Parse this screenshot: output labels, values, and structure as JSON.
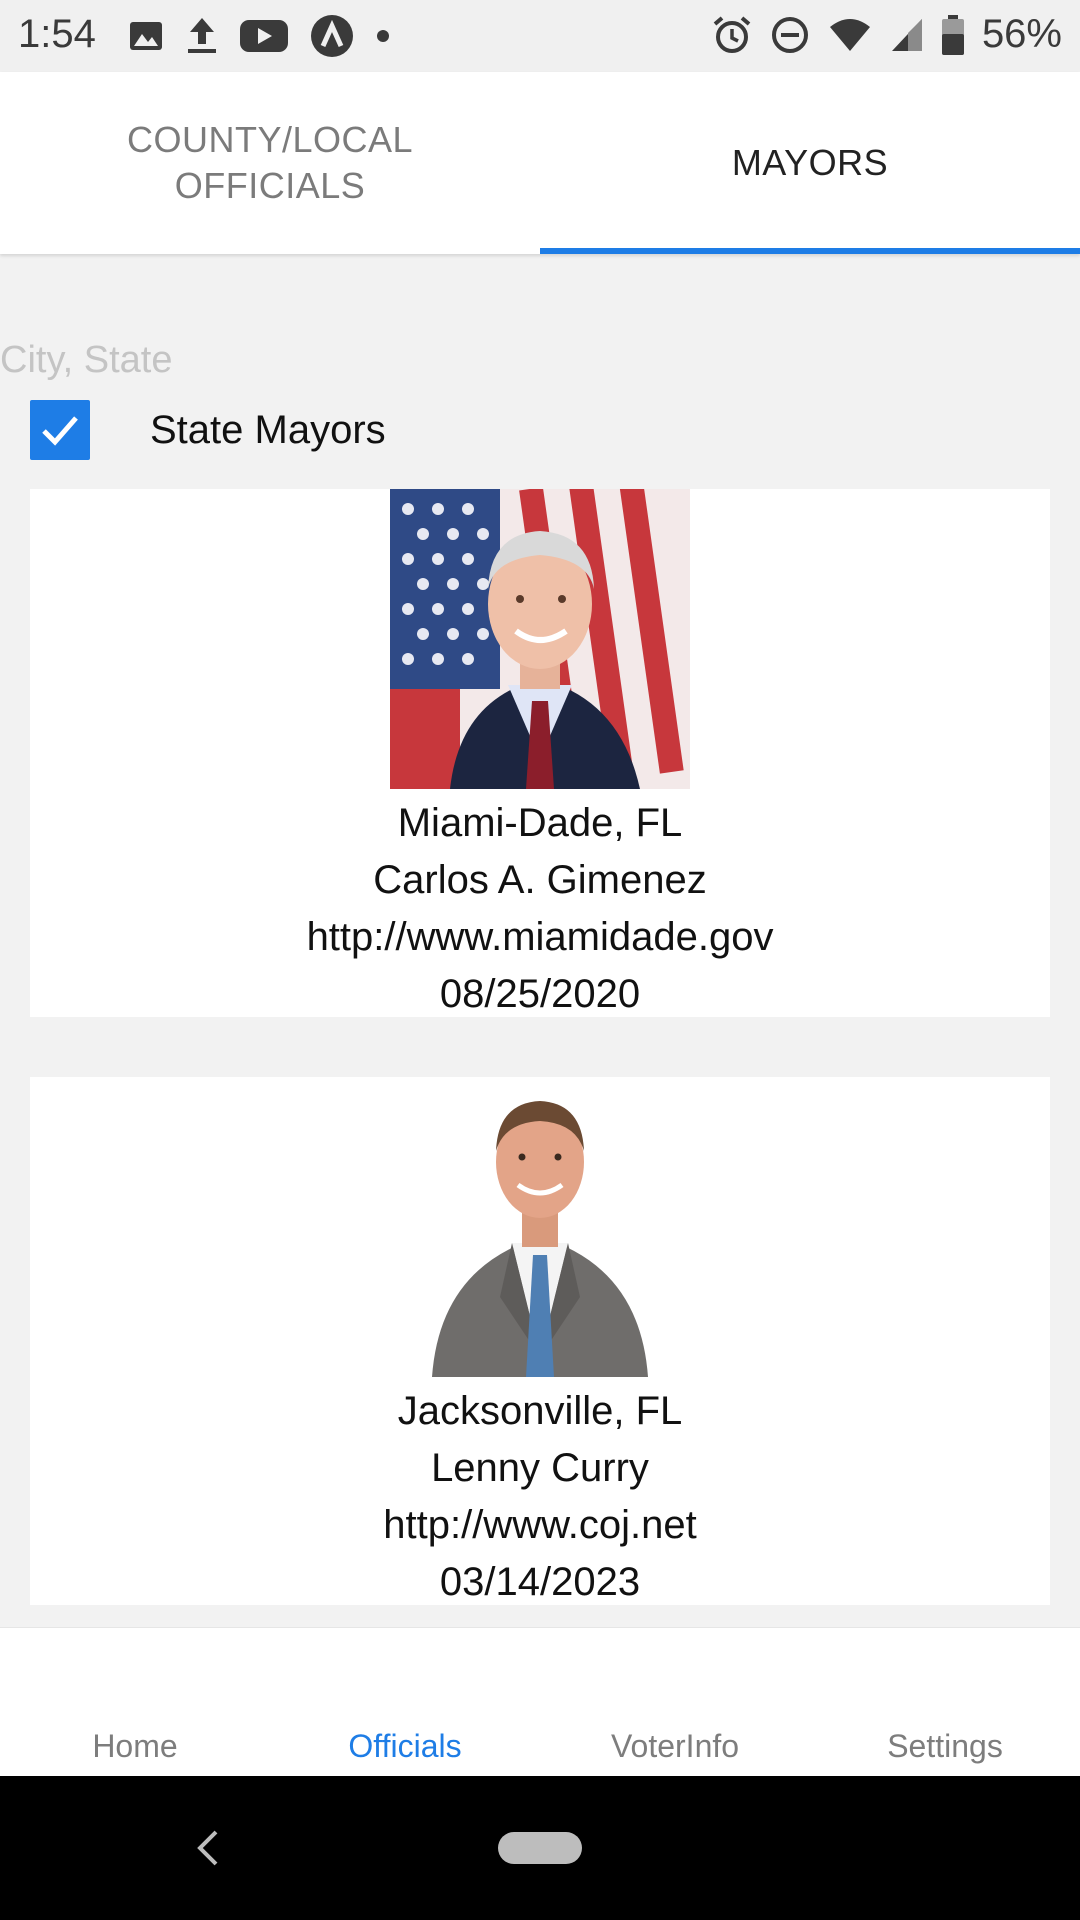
{
  "status_bar": {
    "time": "1:54",
    "battery_percent": "56%",
    "left_icons": [
      "image-icon",
      "upload-icon",
      "youtube-icon",
      "app-a-icon",
      "dot-icon"
    ],
    "right_icons": [
      "alarm-icon",
      "dnd-icon",
      "wifi-icon",
      "signal-icon",
      "battery-icon"
    ]
  },
  "tabs": [
    {
      "label_line1": "COUNTY/LOCAL",
      "label_line2": "OFFICIALS",
      "active": false
    },
    {
      "label": "MAYORS",
      "active": true
    }
  ],
  "search": {
    "placeholder": "City, State",
    "value": ""
  },
  "filter": {
    "label": "State Mayors",
    "checked": true
  },
  "mayors": [
    {
      "location": "Miami-Dade, FL",
      "name": "Carlos A. Gimenez",
      "url": "http://www.miamidade.gov",
      "date": "08/25/2020"
    },
    {
      "location": "Jacksonville, FL",
      "name": "Lenny Curry",
      "url": "http://www.coj.net",
      "date": "03/14/2023"
    }
  ],
  "bottom_nav": [
    {
      "label": "Home",
      "active": false
    },
    {
      "label": "Officials",
      "active": true
    },
    {
      "label": "VoterInfo",
      "active": false
    },
    {
      "label": "Settings",
      "active": false
    }
  ],
  "colors": {
    "accent": "#1e7de6",
    "inactive": "#7d7d7d",
    "background": "#f2f2f2"
  }
}
